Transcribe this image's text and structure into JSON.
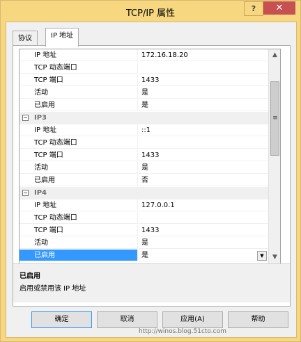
{
  "window": {
    "title": "TCP/IP 属性",
    "help_label": "?",
    "close_label": "✕"
  },
  "tabs": [
    {
      "label": "协议"
    },
    {
      "label": "IP 地址"
    }
  ],
  "grid": {
    "rows_top": [
      {
        "name": "IP 地址",
        "value": "172.16.18.20"
      },
      {
        "name": "TCP 动态端口",
        "value": ""
      },
      {
        "name": "TCP 端口",
        "value": "1433"
      },
      {
        "name": "活动",
        "value": "是"
      },
      {
        "name": "已启用",
        "value": "是"
      }
    ],
    "ip3": {
      "title": "IP3",
      "toggle": "−",
      "rows": [
        {
          "name": "IP 地址",
          "value": "::1"
        },
        {
          "name": "TCP 动态端口",
          "value": ""
        },
        {
          "name": "TCP 端口",
          "value": "1433"
        },
        {
          "name": "活动",
          "value": "是"
        },
        {
          "name": "已启用",
          "value": "否"
        }
      ]
    },
    "ip4": {
      "title": "IP4",
      "toggle": "−",
      "rows": [
        {
          "name": "IP 地址",
          "value": "127.0.0.1"
        },
        {
          "name": "TCP 动态端口",
          "value": ""
        },
        {
          "name": "TCP 端口",
          "value": "1433"
        },
        {
          "name": "活动",
          "value": "是"
        },
        {
          "name": "已启用",
          "value": "是"
        }
      ]
    },
    "scroll_up": "▲",
    "scroll_down": "▼",
    "scroll_grip": "≡"
  },
  "description": {
    "title": "已启用",
    "text": "启用或禁用该 IP 地址"
  },
  "buttons": {
    "ok": "确定",
    "cancel": "取消",
    "apply": "应用(A)",
    "help": "帮助"
  },
  "watermark": "http://winos.blog.51cto.com"
}
